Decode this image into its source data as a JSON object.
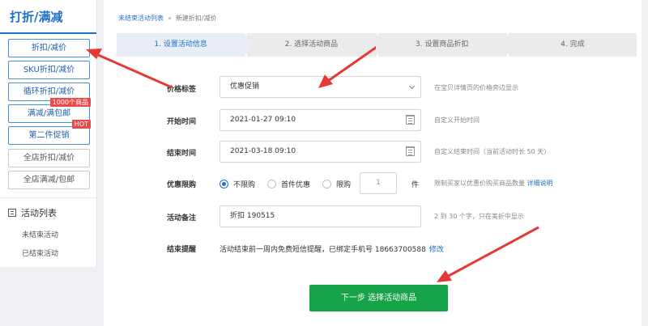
{
  "sidebar": {
    "title": "打折/满减",
    "buttons": [
      {
        "label": "折扣/减价"
      },
      {
        "label": "SKU折扣/减价"
      },
      {
        "label": "循环折扣/减价"
      },
      {
        "label": "满减/满包邮",
        "badge": "1000个商品"
      },
      {
        "label": "第二件促销",
        "badge": "HOT"
      },
      {
        "label": "全店折扣/减价"
      },
      {
        "label": "全店满减/包邮"
      }
    ],
    "section_title": "活动列表",
    "links": [
      "未结束活动",
      "已结束活动"
    ]
  },
  "breadcrumb": {
    "link": "未结束活动列表",
    "separator": "»",
    "current": "新建折扣/减价"
  },
  "steps": [
    "1. 设置活动信息",
    "2. 选择活动商品",
    "3. 设置商品折扣",
    "4. 完成"
  ],
  "form": {
    "price_tag": {
      "label": "价格标签",
      "value": "优惠促销",
      "hint": "在宝贝详情页的价格旁边显示"
    },
    "start_time": {
      "label": "开始时间",
      "value": "2021-01-27 09:10",
      "hint": "自定义开始时间"
    },
    "end_time": {
      "label": "结束时间",
      "value": "2021-03-18 09:10",
      "hint": "自定义结束时间（当前活动时长 50 天）"
    },
    "limit": {
      "label": "优惠限购",
      "options": [
        "不限购",
        "首件优惠",
        "限购"
      ],
      "selected": "不限购",
      "quantity_placeholder": "1",
      "unit": "件",
      "hint": "限制买家以优惠价购买商品数量",
      "hint_link": "详细说明"
    },
    "note": {
      "label": "活动备注",
      "value": "折扣 190515",
      "hint": "2 到 30 个字，只在美折中显示"
    },
    "reminder": {
      "label": "结束提醒",
      "text": "活动结束前一周内免费短信提醒，已绑定手机号 18663700588",
      "link": "修改"
    }
  },
  "next_button": "下一步 选择活动商品",
  "colors": {
    "accent": "#1f6fc9",
    "primary_button": "#16a34a",
    "badge": "#e94b4b",
    "annotation_arrow": "#e53935"
  }
}
